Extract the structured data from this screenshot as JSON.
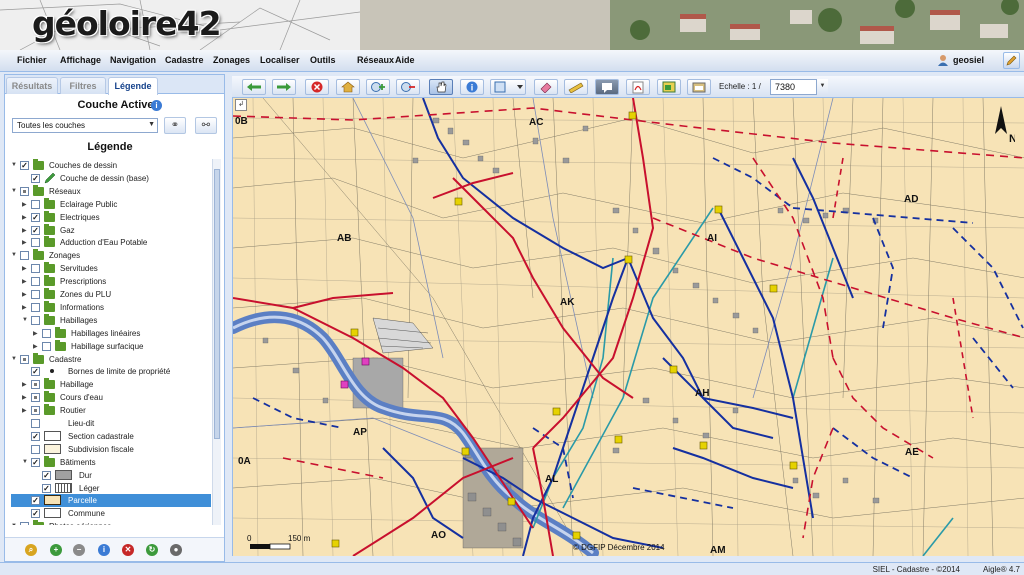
{
  "app": {
    "logo": "géoloire42",
    "user": "geosiel"
  },
  "menu": [
    "Fichier",
    "Affichage",
    "Navigation",
    "Cadastre",
    "Zonages",
    "Localiser",
    "Outils",
    "Réseaux",
    "Aide"
  ],
  "tabs": [
    {
      "label": "Résultats",
      "active": false
    },
    {
      "label": "Filtres",
      "active": false
    },
    {
      "label": "Légende",
      "active": true
    }
  ],
  "panel": {
    "couche_active_title": "Couche Active",
    "layer_select_value": "Toutes les couches",
    "legend_title": "Légende"
  },
  "legend_tree": [
    {
      "label": "Couches de dessin",
      "level": 0,
      "expanded": true,
      "check": "checked",
      "icon": "folder"
    },
    {
      "label": "Couche de dessin (base)",
      "level": 1,
      "check": "checked",
      "icon": "pencil"
    },
    {
      "label": "Réseaux",
      "level": 0,
      "expanded": true,
      "check": "partial",
      "icon": "folder"
    },
    {
      "label": "Eclairage Public",
      "level": 1,
      "expanded": false,
      "check": "unchecked",
      "icon": "folder"
    },
    {
      "label": "Electriques",
      "level": 1,
      "expanded": false,
      "check": "checked",
      "icon": "folder"
    },
    {
      "label": "Gaz",
      "level": 1,
      "expanded": false,
      "check": "checked",
      "icon": "folder"
    },
    {
      "label": "Adduction d'Eau Potable",
      "level": 1,
      "expanded": false,
      "check": "unchecked",
      "icon": "folder"
    },
    {
      "label": "Zonages",
      "level": 0,
      "expanded": true,
      "check": "unchecked",
      "icon": "folder"
    },
    {
      "label": "Servitudes",
      "level": 1,
      "expanded": false,
      "check": "unchecked",
      "icon": "folder"
    },
    {
      "label": "Prescriptions",
      "level": 1,
      "expanded": false,
      "check": "unchecked",
      "icon": "folder"
    },
    {
      "label": "Zones du PLU",
      "level": 1,
      "expanded": false,
      "check": "unchecked",
      "icon": "folder"
    },
    {
      "label": "Informations",
      "level": 1,
      "expanded": false,
      "check": "unchecked",
      "icon": "folder"
    },
    {
      "label": "Habillages",
      "level": 1,
      "expanded": true,
      "check": "unchecked",
      "icon": "folder"
    },
    {
      "label": "Habillages linéaires",
      "level": 2,
      "expanded": false,
      "check": "unchecked",
      "icon": "folder"
    },
    {
      "label": "Habillage surfacique",
      "level": 2,
      "expanded": false,
      "check": "unchecked",
      "icon": "folder"
    },
    {
      "label": "Cadastre",
      "level": 0,
      "expanded": true,
      "check": "partial",
      "icon": "folder"
    },
    {
      "label": "Bornes de limite de propriété",
      "level": 1,
      "check": "checked",
      "icon": "dot"
    },
    {
      "label": "Habillage",
      "level": 1,
      "expanded": false,
      "check": "partial",
      "icon": "folder"
    },
    {
      "label": "Cours d'eau",
      "level": 1,
      "expanded": false,
      "check": "partial",
      "icon": "folder"
    },
    {
      "label": "Routier",
      "level": 1,
      "expanded": false,
      "check": "partial",
      "icon": "folder"
    },
    {
      "label": "Lieu-dit",
      "level": 1,
      "check": "unchecked",
      "icon": "none"
    },
    {
      "label": "Section cadastrale",
      "level": 1,
      "check": "checked",
      "icon": "rect-white"
    },
    {
      "label": "Subdivision fiscale",
      "level": 1,
      "check": "unchecked",
      "icon": "rect-cream"
    },
    {
      "label": "Bâtiments",
      "level": 1,
      "expanded": true,
      "check": "checked",
      "icon": "folder"
    },
    {
      "label": "Dur",
      "level": 2,
      "check": "checked",
      "icon": "rect-gray"
    },
    {
      "label": "Léger",
      "level": 2,
      "check": "checked",
      "icon": "rect-hatch"
    },
    {
      "label": "Parcelle",
      "level": 1,
      "check": "checked",
      "icon": "rect-sel",
      "selected": true
    },
    {
      "label": "Commune",
      "level": 1,
      "check": "checked",
      "icon": "rect-white"
    },
    {
      "label": "Photos aériennes",
      "level": 0,
      "expanded": true,
      "check": "unchecked",
      "icon": "folder"
    }
  ],
  "toolbar": {
    "scale_label": "Echelle : 1 /",
    "scale_value": "7380"
  },
  "map": {
    "sections": [
      "0B",
      "AC",
      "AD",
      "AB",
      "AI",
      "AK",
      "AH",
      "AP",
      "AE",
      "0A",
      "AL",
      "AO",
      "AM"
    ],
    "scale_zero": "0",
    "scale_bar": "150 m",
    "copyright": "© DGFIP Décembre 2014",
    "north": "N",
    "colors": {
      "parcel_fill": "#f7e3b6",
      "road_red": "#c8102e",
      "network_blue": "#1530a0",
      "river": "#5b7fc4",
      "teal": "#2a9aa8"
    }
  },
  "status": {
    "text": "SIEL - Cadastre - ©2014",
    "version": "Aigle® 4.7"
  }
}
